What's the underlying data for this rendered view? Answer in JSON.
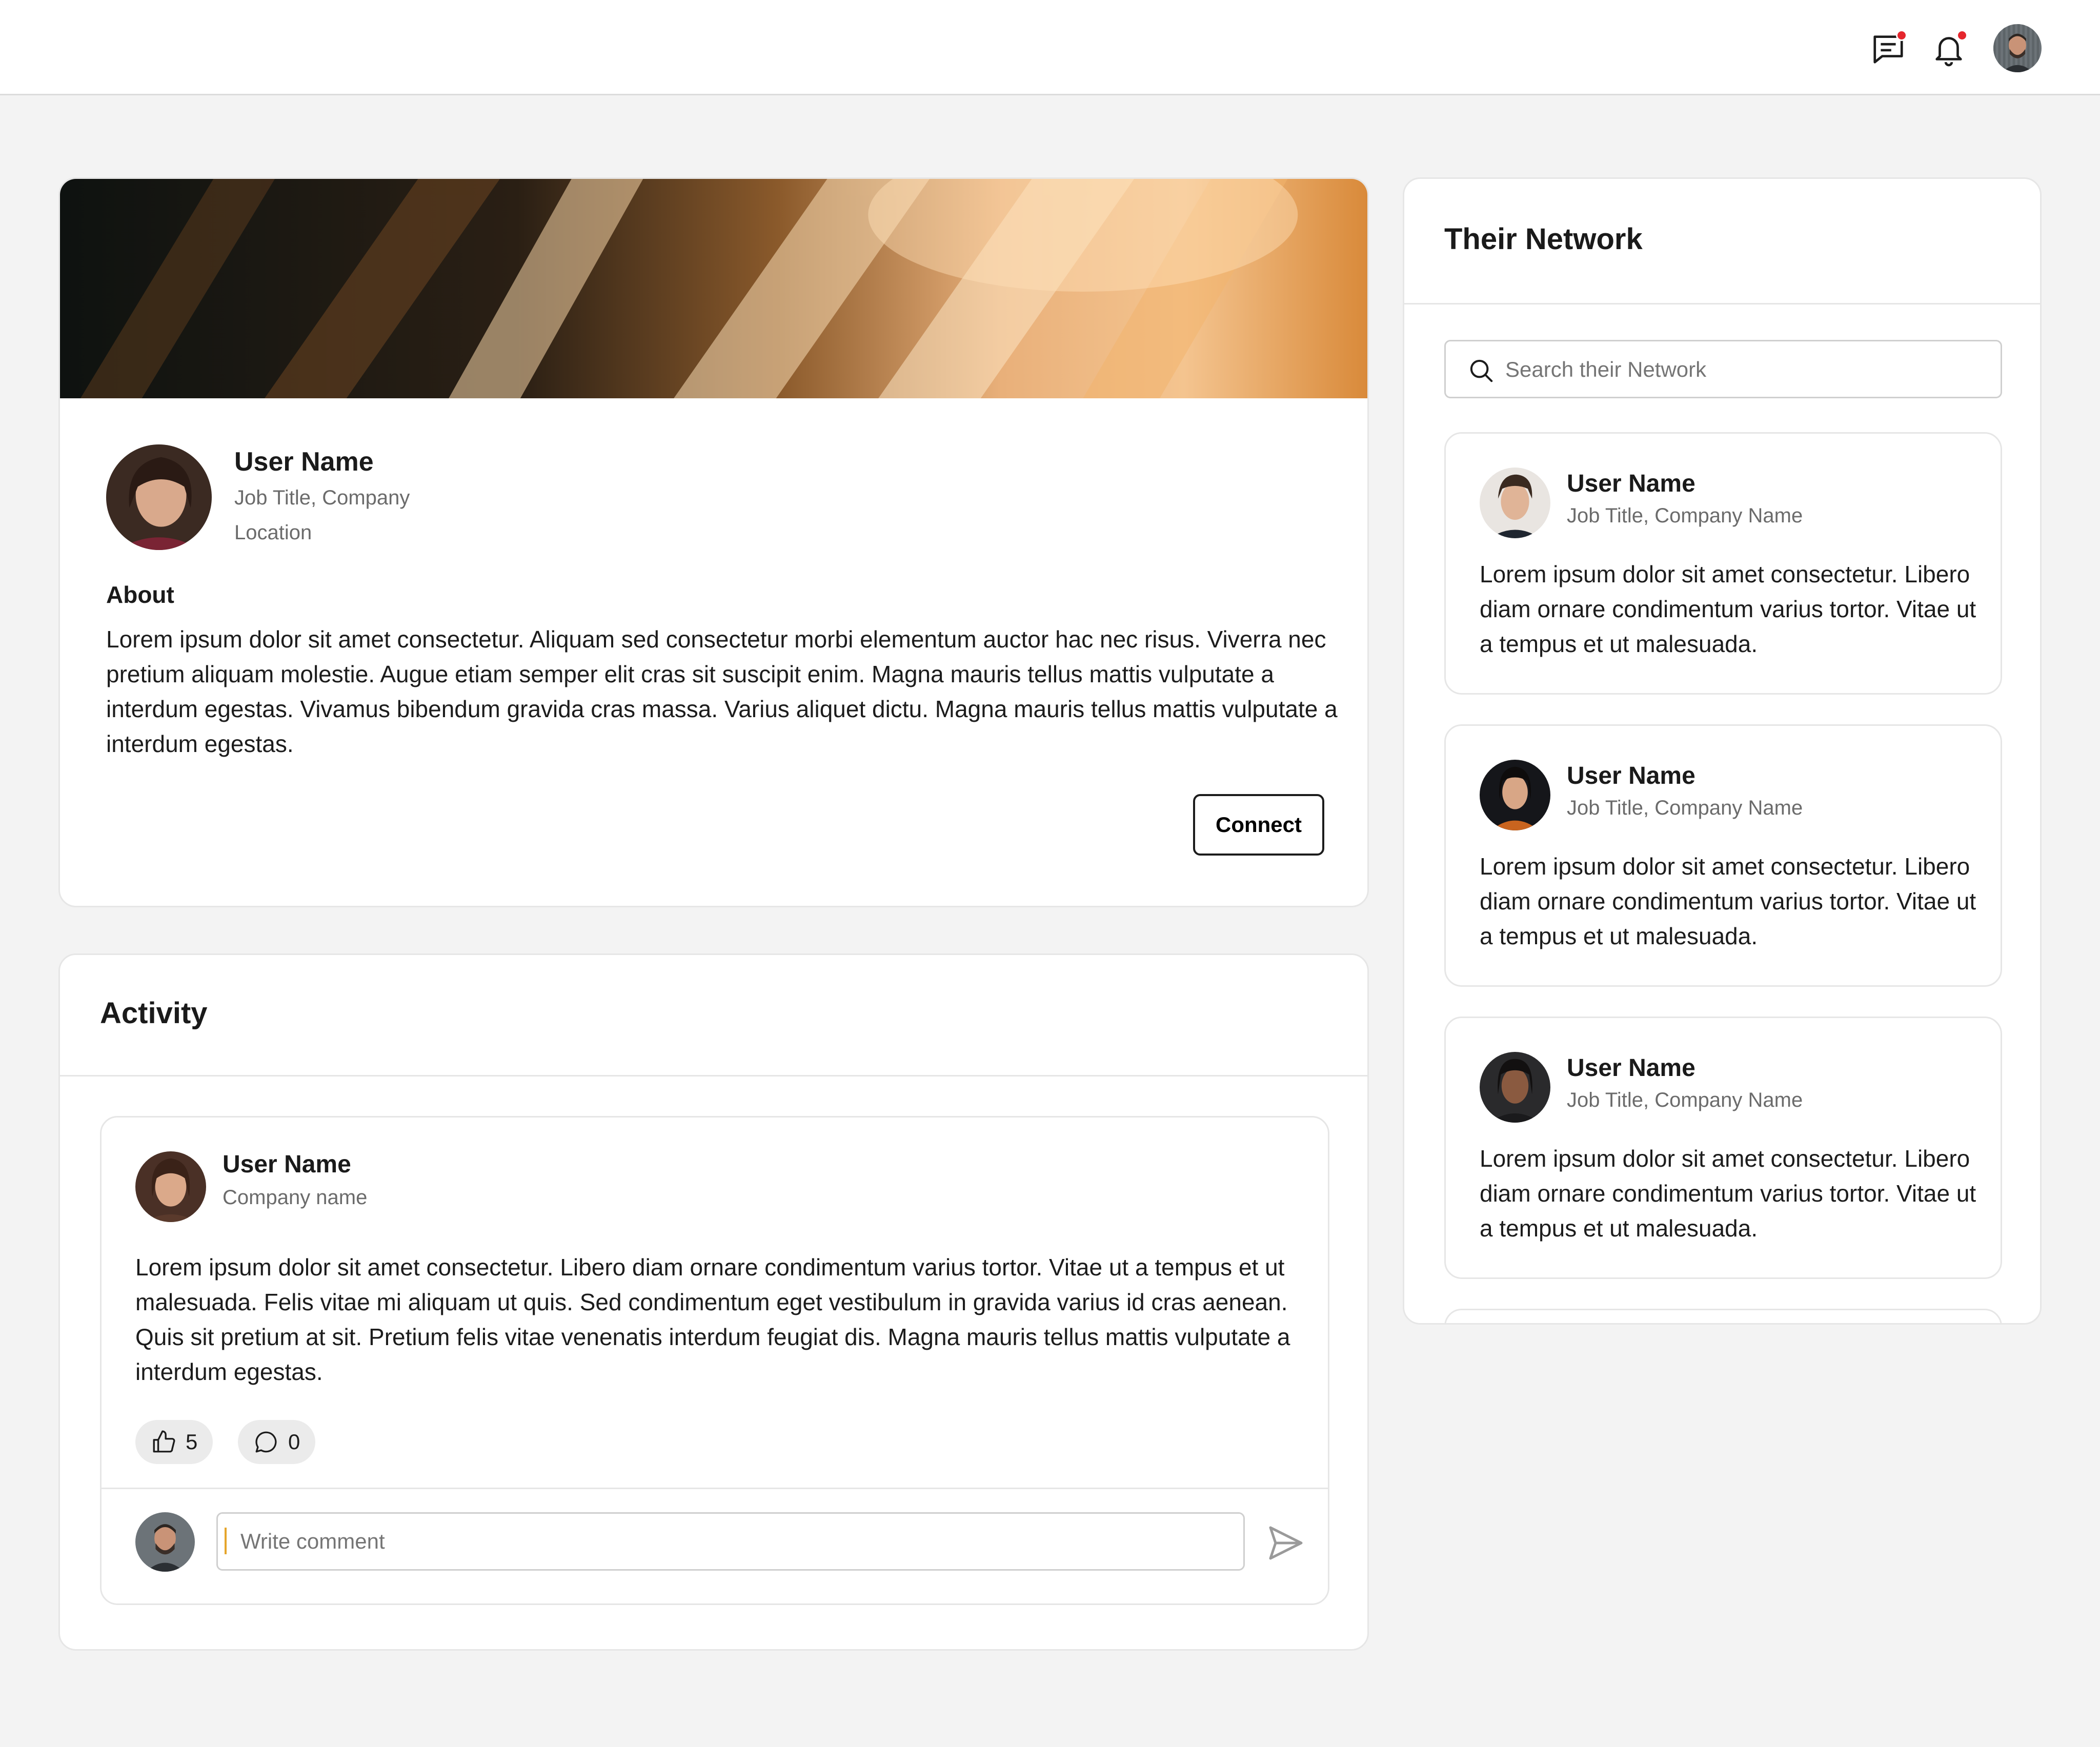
{
  "topbar": {
    "icons": [
      "messages-icon",
      "notifications-icon"
    ],
    "has_unread_messages": true,
    "has_unread_notifications": true
  },
  "profile": {
    "name": "User Name",
    "job": "Job Title, Company",
    "location": "Location",
    "about_heading": "About",
    "about_text": "Lorem ipsum dolor sit amet consectetur. Aliquam sed consectetur morbi elementum auctor hac nec risus. Viverra nec pretium aliquam molestie. Augue etiam semper elit cras sit suscipit enim. Magna mauris tellus mattis vulputate a interdum egestas. Vivamus bibendum gravida cras massa. Varius aliquet dictu. Magna mauris tellus mattis vulputate a interdum egestas.",
    "connect_label": "Connect"
  },
  "activity": {
    "title": "Activity",
    "post": {
      "author": "User Name",
      "company": "Company name",
      "body": "Lorem ipsum dolor sit amet consectetur. Libero diam ornare condimentum varius tortor. Vitae ut a tempus et ut malesuada. Felis vitae mi aliquam ut quis. Sed condimentum eget vestibulum in gravida varius id cras aenean. Quis sit pretium at sit. Pretium felis vitae venenatis interdum feugiat dis. Magna mauris tellus mattis vulputate a interdum egestas.",
      "likes": "5",
      "comments": "0",
      "comment_placeholder": "Write comment"
    }
  },
  "network": {
    "title": "Their Network",
    "search_placeholder": "Search their Network",
    "items": [
      {
        "name": "User Name",
        "job": "Job Title, Company Name",
        "text": "Lorem ipsum dolor sit amet consectetur. Libero diam ornare condimentum varius tortor. Vitae ut a tempus et ut malesuada."
      },
      {
        "name": "User Name",
        "job": "Job Title, Company Name",
        "text": "Lorem ipsum dolor sit amet consectetur. Libero diam ornare condimentum varius tortor. Vitae ut a tempus et ut malesuada."
      },
      {
        "name": "User Name",
        "job": "Job Title, Company Name",
        "text": "Lorem ipsum dolor sit amet consectetur. Libero diam ornare condimentum varius tortor. Vitae ut a tempus et ut malesuada."
      }
    ]
  },
  "colors": {
    "page_bg": "#f3f3f3",
    "card_bg": "#ffffff",
    "badge_red": "#e5262d",
    "muted_text": "#6b6b6b"
  }
}
